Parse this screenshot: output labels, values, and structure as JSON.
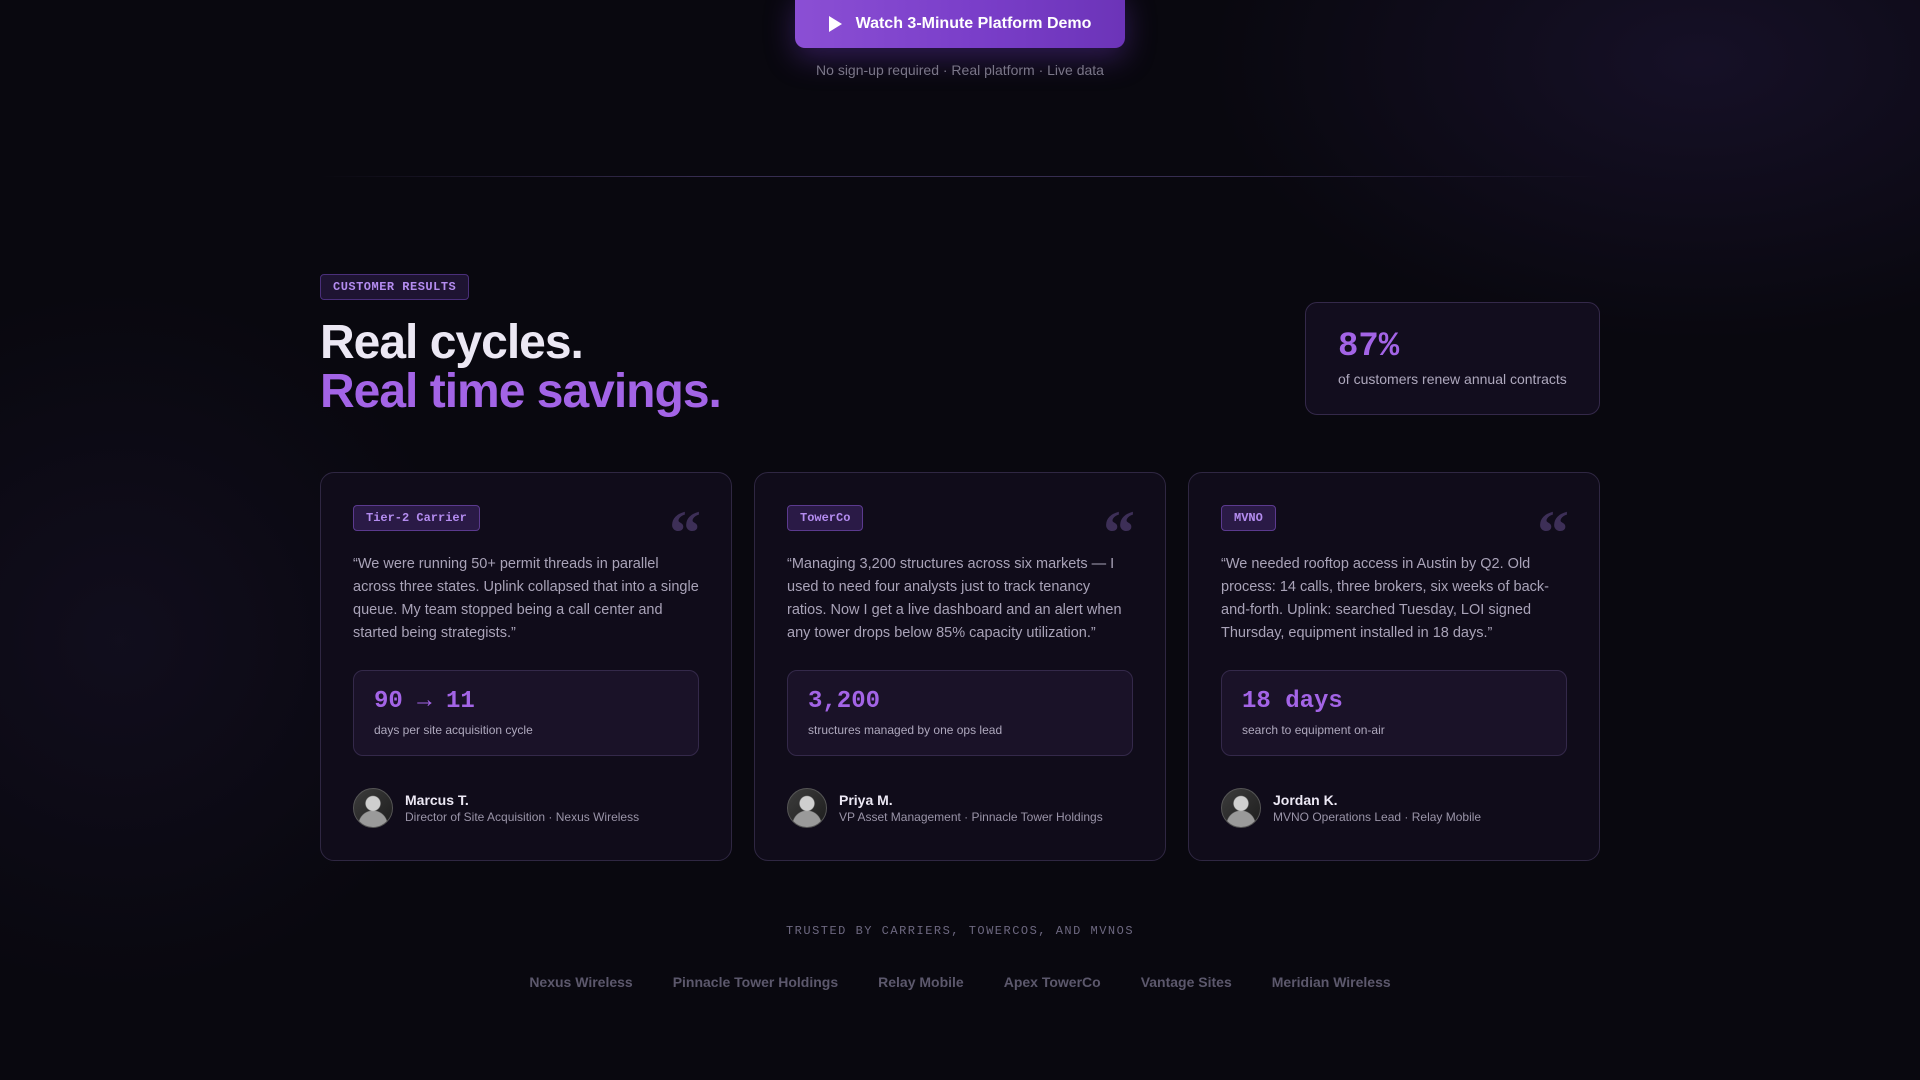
{
  "hero": {
    "cta_label": "Watch 3-Minute Platform Demo",
    "subtext": "No sign-up required · Real platform · Live data"
  },
  "section": {
    "eyebrow": "CUSTOMER RESULTS",
    "headline_line1": "Real cycles.",
    "headline_line2": "Real time savings.",
    "stat": {
      "value": "87%",
      "caption": "of customers renew annual contracts"
    }
  },
  "testimonials": [
    {
      "tag": "Tier-2 Carrier",
      "quote": "“We were running 50+ permit threads in parallel across three states. Uplink collapsed that into a single queue. My team stopped being a call center and started being strategists.”",
      "metric_value": "90 → 11",
      "metric_label": "days per site acquisition cycle",
      "name": "Marcus T.",
      "role": "Director of Site Acquisition · Nexus Wireless"
    },
    {
      "tag": "TowerCo",
      "quote": "“Managing 3,200 structures across six markets — I used to need four analysts just to track tenancy ratios. Now I get a live dashboard and an alert when any tower drops below 85% capacity utilization.”",
      "metric_value": "3,200",
      "metric_label": "structures managed by one ops lead",
      "name": "Priya M.",
      "role": "VP Asset Management · Pinnacle Tower Holdings"
    },
    {
      "tag": "MVNO",
      "quote": "“We needed rooftop access in Austin by Q2. Old process: 14 calls, three brokers, six weeks of back-and-forth. Uplink: searched Tuesday, LOI signed Thursday, equipment installed in 18 days.”",
      "metric_value": "18 days",
      "metric_label": "search to equipment on-air",
      "name": "Jordan K.",
      "role": "MVNO Operations Lead · Relay Mobile"
    }
  ],
  "trusted": {
    "label": "TRUSTED BY CARRIERS, TOWERCOS, AND MVNOS",
    "logos": [
      "Nexus Wireless",
      "Pinnacle Tower Holdings",
      "Relay Mobile",
      "Apex TowerCo",
      "Vantage Sites",
      "Meridian Wireless"
    ]
  },
  "colors": {
    "accent": "#a364e6",
    "background": "#09080f",
    "cta": "#7a3ec9"
  }
}
